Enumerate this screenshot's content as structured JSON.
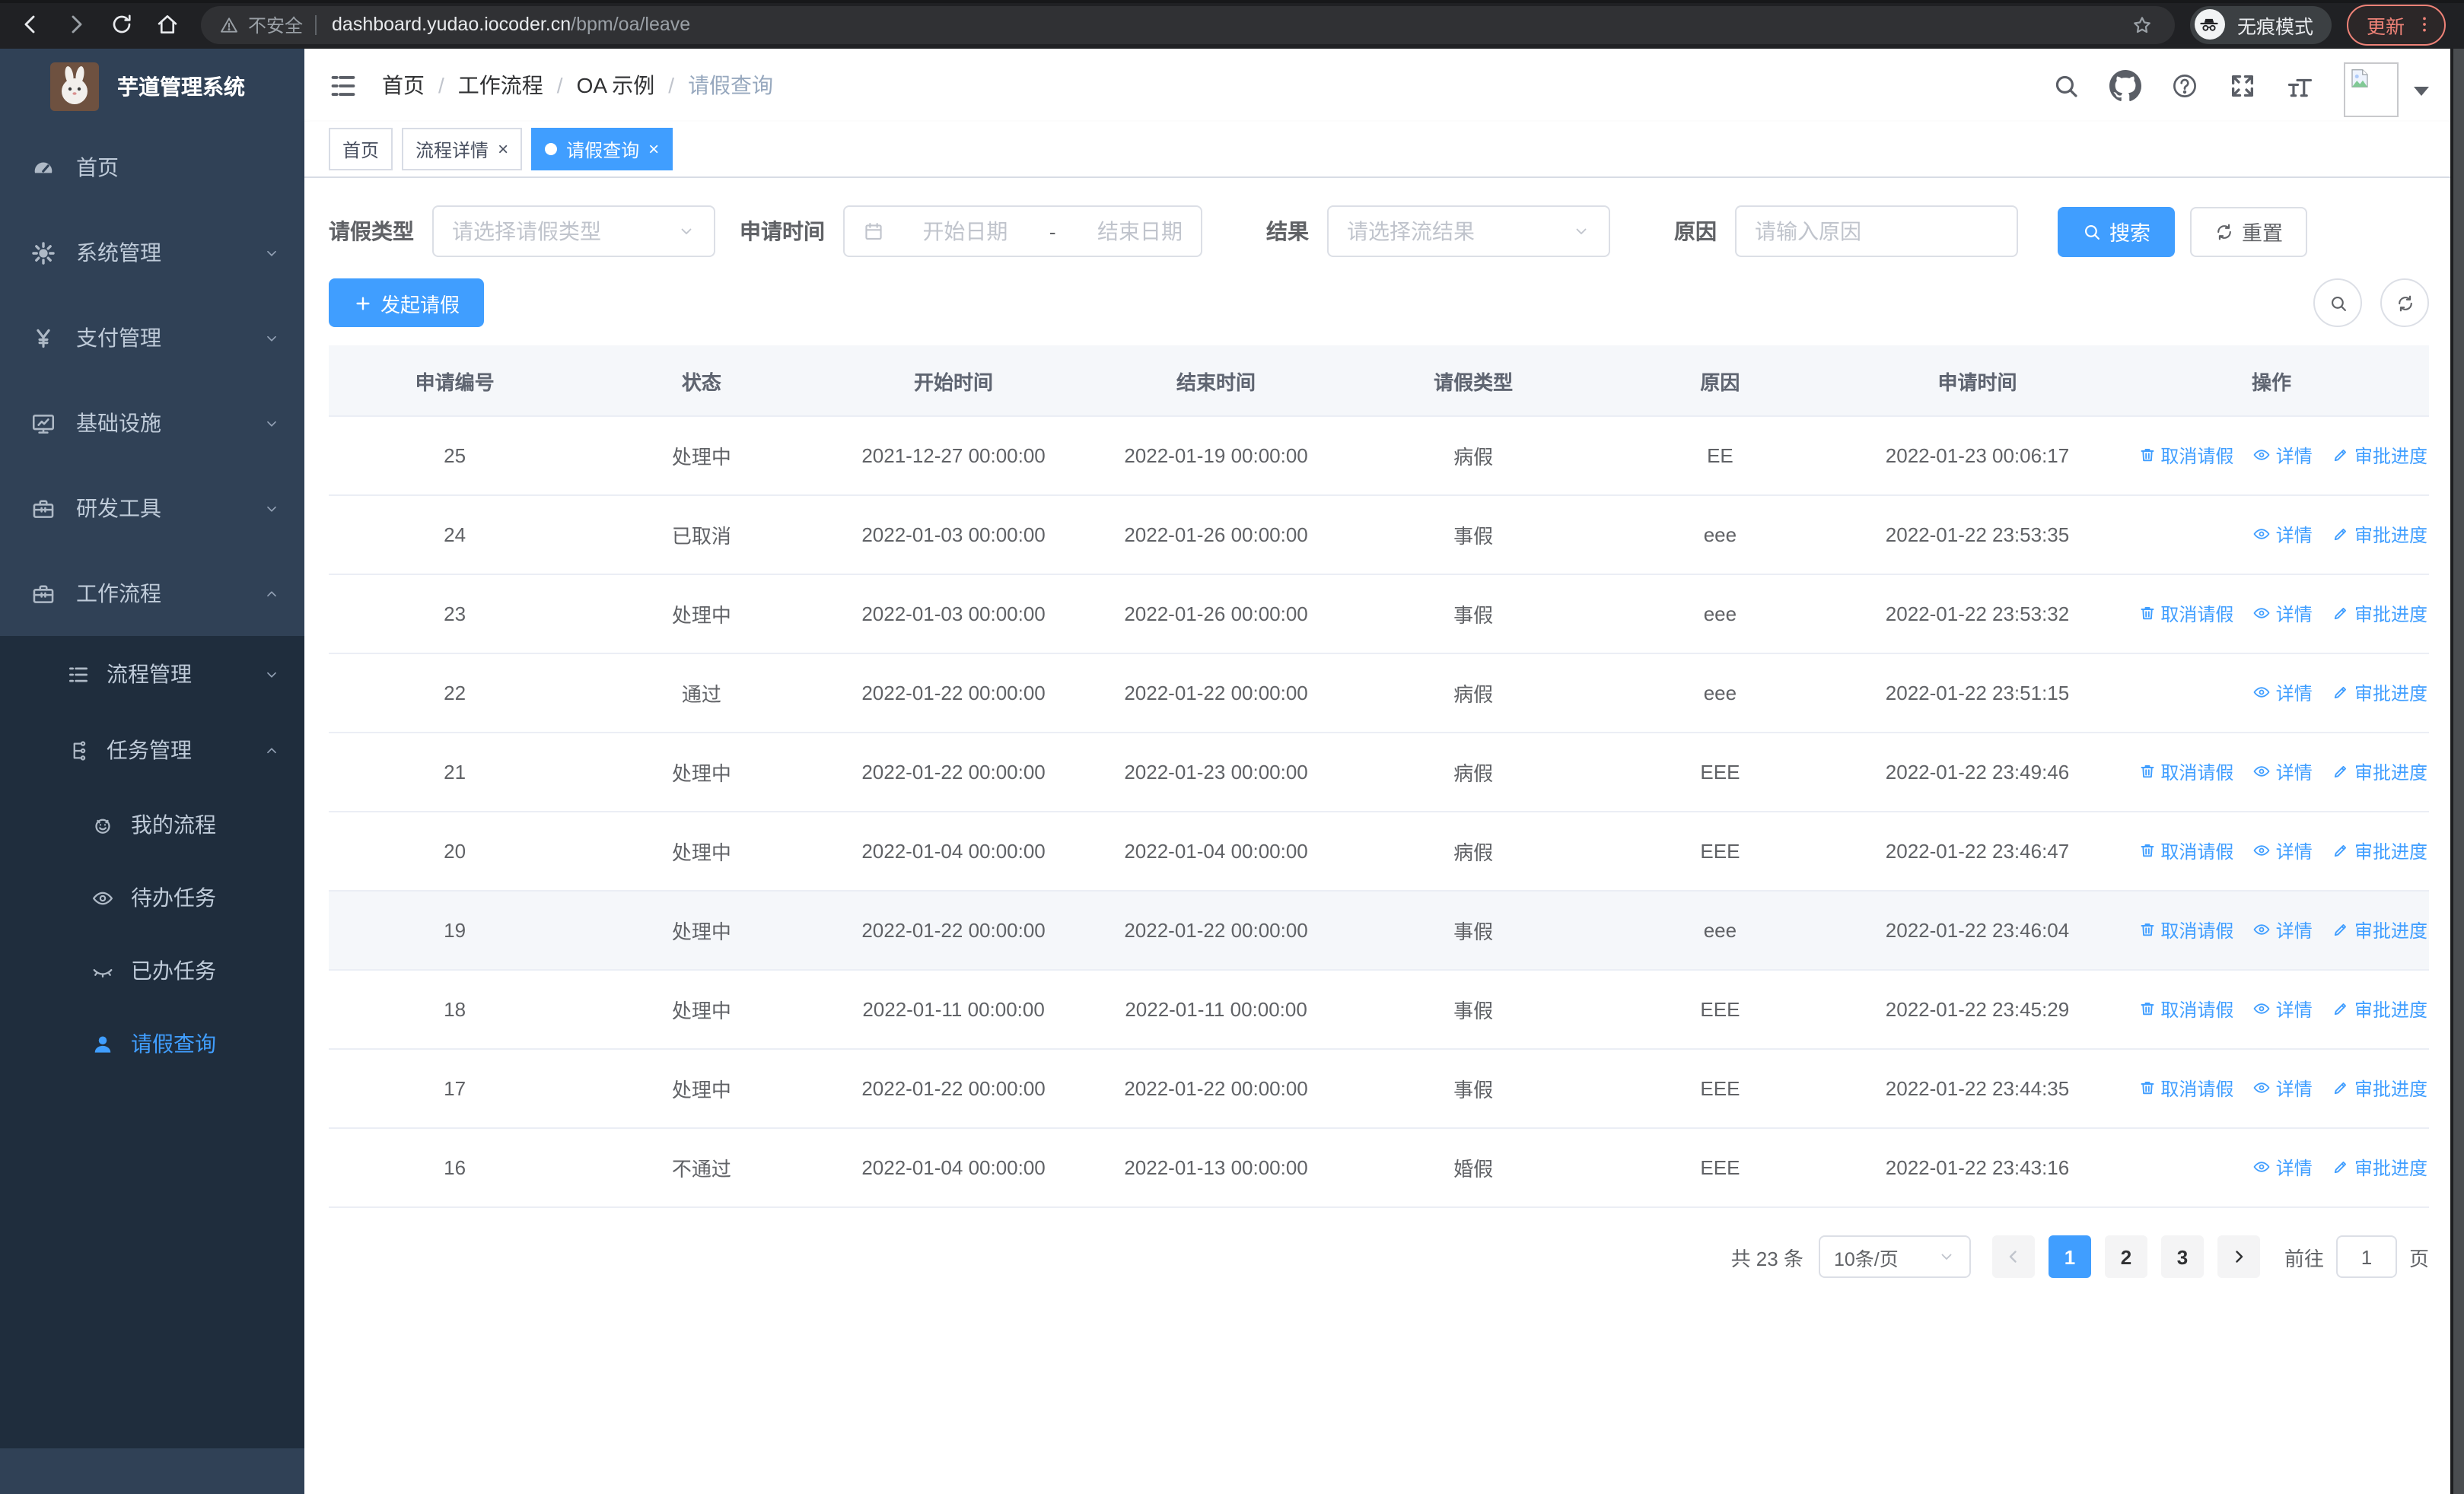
{
  "colors": {
    "primary": "#409eff",
    "sidebar_bg": "#304156",
    "submenu_bg": "#1f2d3d",
    "update_button_accent": "#ee8277"
  },
  "symbols": {
    "close": "×"
  },
  "browser": {
    "security_label": "不安全",
    "url_host": "dashboard.yudao.iocoder.cn",
    "url_path": "/bpm/oa/leave",
    "incognito_label": "无痕模式",
    "update_label": "更新"
  },
  "sidebar": {
    "app_title": "芋道管理系统",
    "menu": [
      {
        "label": "首页",
        "icon": "dashboard-icon",
        "level": 0,
        "section": "top",
        "chevron": "",
        "active": false
      },
      {
        "label": "系统管理",
        "icon": "gear-icon",
        "level": 0,
        "section": "top",
        "chevron": "down",
        "active": false
      },
      {
        "label": "支付管理",
        "icon": "yen-icon",
        "level": 0,
        "section": "top",
        "chevron": "down",
        "active": false
      },
      {
        "label": "基础设施",
        "icon": "monitor-icon",
        "level": 0,
        "section": "top",
        "chevron": "down",
        "active": false
      },
      {
        "label": "研发工具",
        "icon": "toolbox-icon",
        "level": 0,
        "section": "top",
        "chevron": "down",
        "active": false
      },
      {
        "label": "工作流程",
        "icon": "briefcase-icon",
        "level": 0,
        "section": "top",
        "chevron": "up",
        "active": false
      },
      {
        "label": "流程管理",
        "icon": "list-icon",
        "level": 1,
        "section": "sub",
        "chevron": "down",
        "active": false
      },
      {
        "label": "任务管理",
        "icon": "flow-icon",
        "level": 1,
        "section": "sub",
        "chevron": "up",
        "active": false
      },
      {
        "label": "我的流程",
        "icon": "robot-icon",
        "level": 2,
        "section": "sub",
        "chevron": "",
        "active": false
      },
      {
        "label": "待办任务",
        "icon": "eye-icon",
        "level": 2,
        "section": "sub",
        "chevron": "",
        "active": false
      },
      {
        "label": "已办任务",
        "icon": "eye-closed-icon",
        "level": 2,
        "section": "sub",
        "chevron": "",
        "active": false
      },
      {
        "label": "请假查询",
        "icon": "user-icon",
        "level": 2,
        "section": "sub",
        "chevron": "",
        "active": true
      }
    ]
  },
  "topbar": {
    "breadcrumb": [
      "首页",
      "工作流程",
      "OA 示例",
      "请假查询"
    ],
    "separator": "/"
  },
  "tabs": [
    {
      "label": "首页",
      "closable": false,
      "active": false
    },
    {
      "label": "流程详情",
      "closable": true,
      "active": false
    },
    {
      "label": "请假查询",
      "closable": true,
      "active": true
    }
  ],
  "filters": {
    "type_label": "请假类型",
    "type_placeholder": "请选择请假类型",
    "time_label": "申请时间",
    "start_placeholder": "开始日期",
    "range_separator": "-",
    "end_placeholder": "结束日期",
    "result_label": "结果",
    "result_placeholder": "请选择流结果",
    "reason_label": "原因",
    "reason_placeholder": "请输入原因",
    "search_label": "搜索",
    "reset_label": "重置"
  },
  "toolbar": {
    "create_label": "发起请假"
  },
  "table": {
    "columns": [
      "申请编号",
      "状态",
      "开始时间",
      "结束时间",
      "请假类型",
      "原因",
      "申请时间",
      "操作"
    ],
    "action_labels": {
      "cancel": "取消请假",
      "detail": "详情",
      "progress": "审批进度"
    },
    "rows": [
      {
        "id": "25",
        "status": "处理中",
        "start": "2021-12-27 00:00:00",
        "end": "2022-01-19 00:00:00",
        "type": "病假",
        "reason": "EE",
        "applied": "2022-01-23 00:06:17",
        "actions": [
          "cancel",
          "detail",
          "progress"
        ],
        "highlighted": false
      },
      {
        "id": "24",
        "status": "已取消",
        "start": "2022-01-03 00:00:00",
        "end": "2022-01-26 00:00:00",
        "type": "事假",
        "reason": "eee",
        "applied": "2022-01-22 23:53:35",
        "actions": [
          "detail",
          "progress"
        ],
        "highlighted": false
      },
      {
        "id": "23",
        "status": "处理中",
        "start": "2022-01-03 00:00:00",
        "end": "2022-01-26 00:00:00",
        "type": "事假",
        "reason": "eee",
        "applied": "2022-01-22 23:53:32",
        "actions": [
          "cancel",
          "detail",
          "progress"
        ],
        "highlighted": false
      },
      {
        "id": "22",
        "status": "通过",
        "start": "2022-01-22 00:00:00",
        "end": "2022-01-22 00:00:00",
        "type": "病假",
        "reason": "eee",
        "applied": "2022-01-22 23:51:15",
        "actions": [
          "detail",
          "progress"
        ],
        "highlighted": false
      },
      {
        "id": "21",
        "status": "处理中",
        "start": "2022-01-22 00:00:00",
        "end": "2022-01-23 00:00:00",
        "type": "病假",
        "reason": "EEE",
        "applied": "2022-01-22 23:49:46",
        "actions": [
          "cancel",
          "detail",
          "progress"
        ],
        "highlighted": false
      },
      {
        "id": "20",
        "status": "处理中",
        "start": "2022-01-04 00:00:00",
        "end": "2022-01-04 00:00:00",
        "type": "病假",
        "reason": "EEE",
        "applied": "2022-01-22 23:46:47",
        "actions": [
          "cancel",
          "detail",
          "progress"
        ],
        "highlighted": false
      },
      {
        "id": "19",
        "status": "处理中",
        "start": "2022-01-22 00:00:00",
        "end": "2022-01-22 00:00:00",
        "type": "事假",
        "reason": "eee",
        "applied": "2022-01-22 23:46:04",
        "actions": [
          "cancel",
          "detail",
          "progress"
        ],
        "highlighted": true
      },
      {
        "id": "18",
        "status": "处理中",
        "start": "2022-01-11 00:00:00",
        "end": "2022-01-11 00:00:00",
        "type": "事假",
        "reason": "EEE",
        "applied": "2022-01-22 23:45:29",
        "actions": [
          "cancel",
          "detail",
          "progress"
        ],
        "highlighted": false
      },
      {
        "id": "17",
        "status": "处理中",
        "start": "2022-01-22 00:00:00",
        "end": "2022-01-22 00:00:00",
        "type": "事假",
        "reason": "EEE",
        "applied": "2022-01-22 23:44:35",
        "actions": [
          "cancel",
          "detail",
          "progress"
        ],
        "highlighted": false
      },
      {
        "id": "16",
        "status": "不通过",
        "start": "2022-01-04 00:00:00",
        "end": "2022-01-13 00:00:00",
        "type": "婚假",
        "reason": "EEE",
        "applied": "2022-01-22 23:43:16",
        "actions": [
          "detail",
          "progress"
        ],
        "highlighted": false
      }
    ]
  },
  "pagination": {
    "total_label": "共 23 条",
    "page_size_label": "10条/页",
    "pages": [
      "1",
      "2",
      "3"
    ],
    "active_page": "1",
    "goto_label": "前往",
    "goto_value": "1",
    "page_unit_label": "页"
  }
}
